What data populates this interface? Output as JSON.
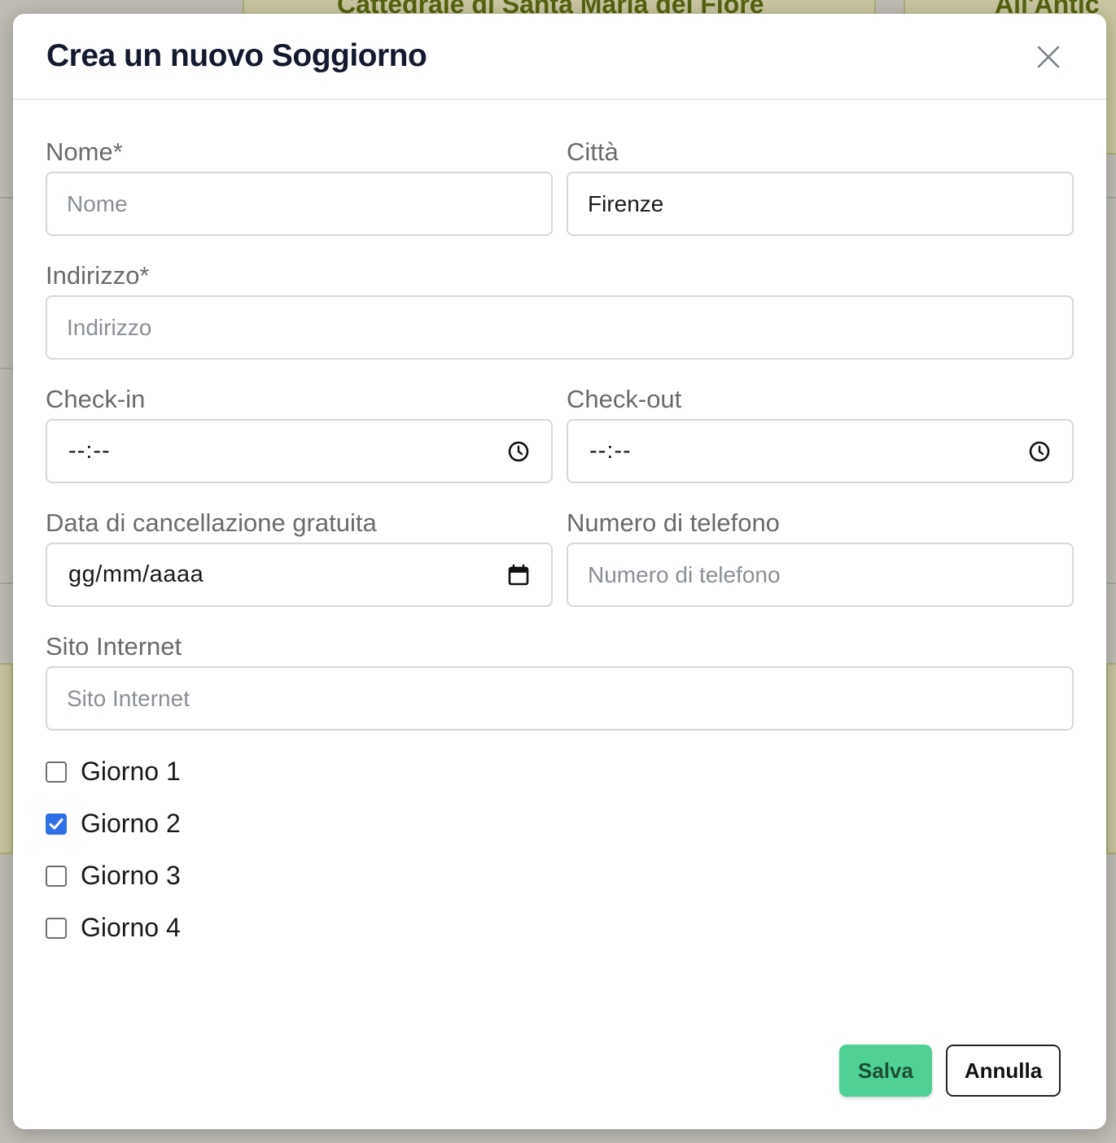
{
  "background": {
    "card_left_title": "Cattedrale di Santa Maria del Fiore",
    "card_right_title": "All'Antic"
  },
  "modal": {
    "title": "Crea un nuovo Soggiorno",
    "close_icon": "close-icon"
  },
  "form": {
    "nome": {
      "label": "Nome*",
      "placeholder": "Nome",
      "value": ""
    },
    "citta": {
      "label": "Città",
      "placeholder": "Città",
      "value": "Firenze"
    },
    "indirizzo": {
      "label": "Indirizzo*",
      "placeholder": "Indirizzo",
      "value": ""
    },
    "checkin": {
      "label": "Check-in",
      "value": "--:--",
      "icon": "clock-icon"
    },
    "checkout": {
      "label": "Check-out",
      "value": "--:--",
      "icon": "clock-icon"
    },
    "cancellazione": {
      "label": "Data di cancellazione gratuita",
      "value": "gg/mm/aaaa",
      "icon": "calendar-icon"
    },
    "telefono": {
      "label": "Numero di telefono",
      "placeholder": "Numero di telefono",
      "value": ""
    },
    "sito": {
      "label": "Sito Internet",
      "placeholder": "Sito Internet",
      "value": ""
    },
    "giorni": [
      {
        "label": "Giorno 1",
        "checked": false
      },
      {
        "label": "Giorno 2",
        "checked": true
      },
      {
        "label": "Giorno 3",
        "checked": false
      },
      {
        "label": "Giorno 4",
        "checked": false
      }
    ]
  },
  "buttons": {
    "save": "Salva",
    "cancel": "Annulla"
  },
  "colors": {
    "save_bg": "#4fd195",
    "checkbox_checked": "#2f6fe8",
    "title": "#141a2e"
  }
}
